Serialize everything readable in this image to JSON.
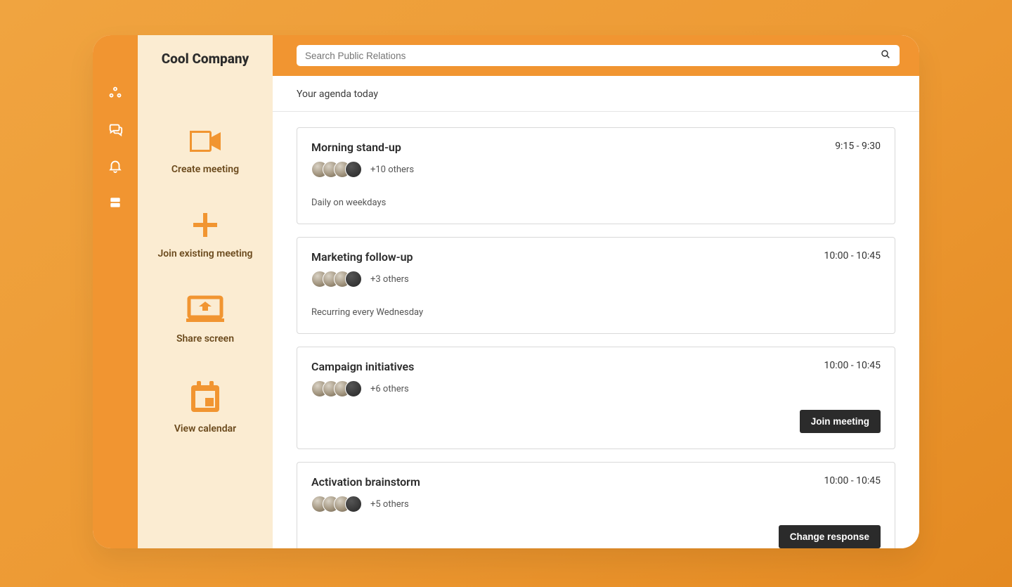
{
  "brand": "Cool Company",
  "rail_icons": [
    "share-nodes-icon",
    "chat-icon",
    "bell-icon",
    "cards-icon"
  ],
  "sidebar": {
    "actions": [
      {
        "id": "create-meeting",
        "label": "Create meeting",
        "icon": "video-icon"
      },
      {
        "id": "join-existing",
        "label": "Join existing meeting",
        "icon": "plus-icon"
      },
      {
        "id": "share-screen",
        "label": "Share screen",
        "icon": "screen-share-icon"
      },
      {
        "id": "view-calendar",
        "label": "View calendar",
        "icon": "calendar-icon"
      }
    ]
  },
  "search": {
    "placeholder": "Search Public Relations"
  },
  "section_title": "Your agenda today",
  "agenda": [
    {
      "title": "Morning stand-up",
      "time": "9:15 - 9:30",
      "others": "+10 others",
      "recurrence": "Daily on weekdays",
      "avatars": [
        "light",
        "light",
        "light",
        "dark"
      ],
      "button": null
    },
    {
      "title": "Marketing follow-up",
      "time": "10:00 - 10:45",
      "others": "+3 others",
      "recurrence": "Recurring every Wednesday",
      "avatars": [
        "light",
        "light",
        "light",
        "dark"
      ],
      "button": null
    },
    {
      "title": "Campaign initiatives",
      "time": "10:00 - 10:45",
      "others": "+6 others",
      "recurrence": null,
      "avatars": [
        "light",
        "light",
        "light",
        "dark"
      ],
      "button": "Join meeting"
    },
    {
      "title": "Activation brainstorm",
      "time": "10:00 - 10:45",
      "others": "+5 others",
      "recurrence": null,
      "avatars": [
        "light",
        "light",
        "light",
        "dark"
      ],
      "button": "Change response"
    }
  ]
}
